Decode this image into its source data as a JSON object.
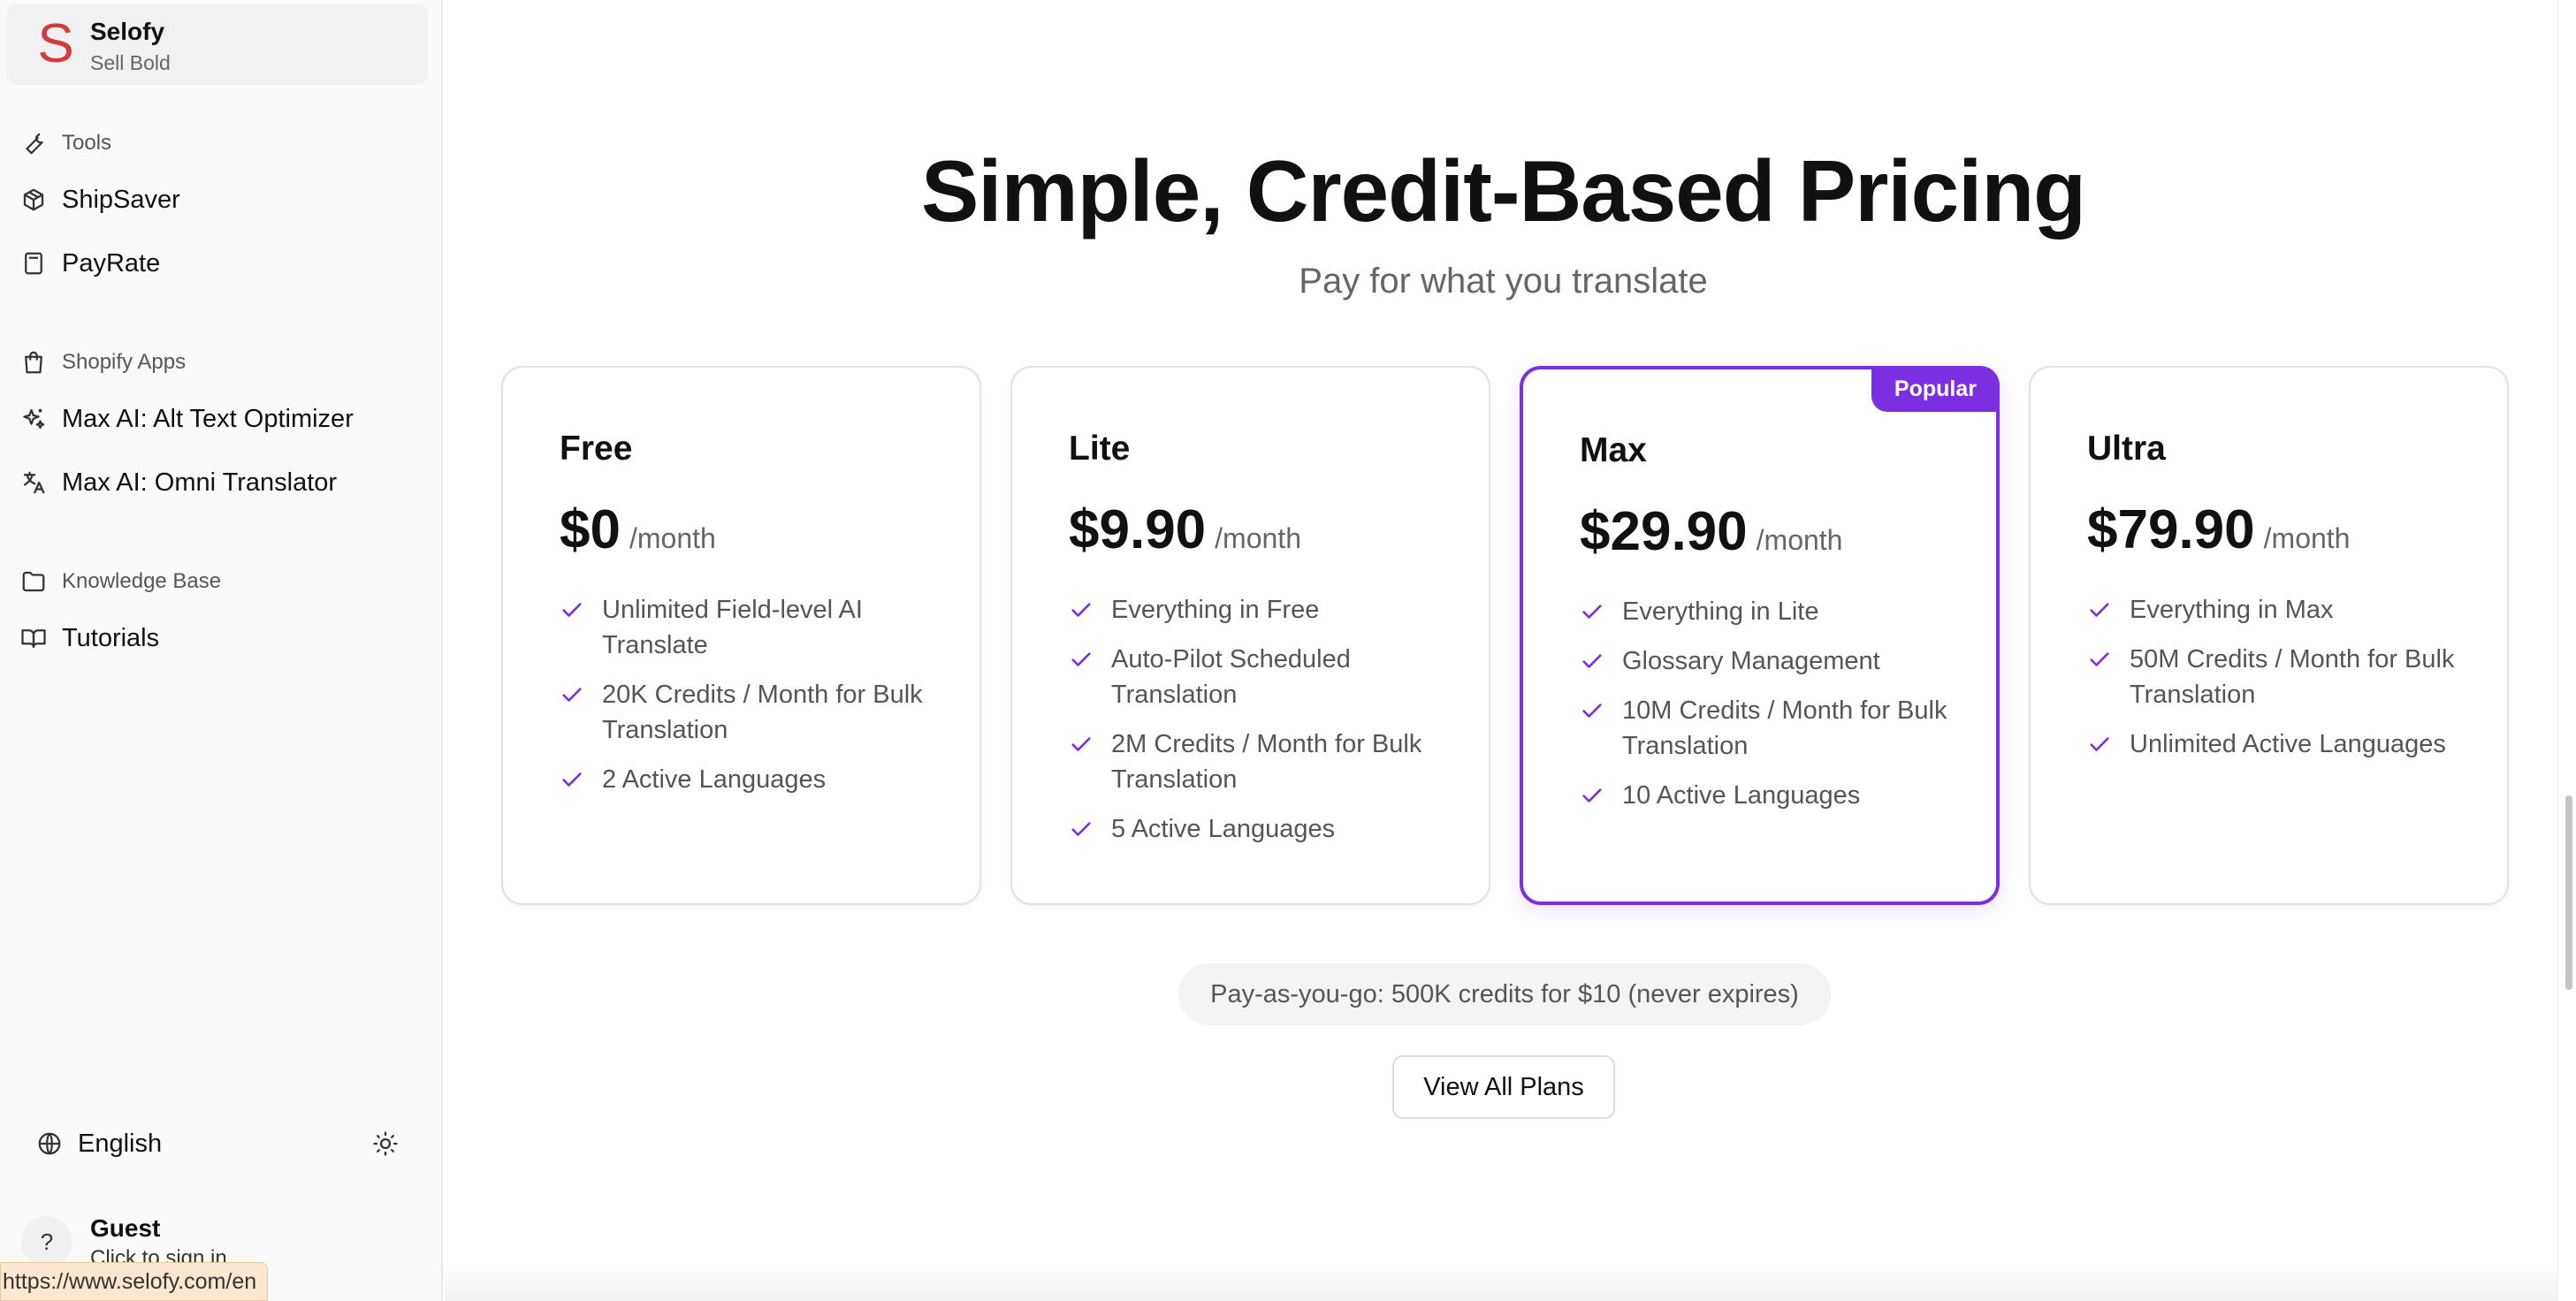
{
  "brand": {
    "logo_letter": "S",
    "name": "Selofy",
    "tagline": "Sell Bold"
  },
  "sidebar": {
    "sections": [
      {
        "label": "Tools",
        "icon": "wrench-icon"
      },
      {
        "label": "Shopify Apps",
        "icon": "shopping-bag-icon"
      },
      {
        "label": "Knowledge Base",
        "icon": "folder-icon"
      }
    ],
    "items": [
      {
        "label": "ShipSaver",
        "icon": "package-icon"
      },
      {
        "label": "PayRate",
        "icon": "calculator-icon"
      },
      {
        "label": "Max AI: Alt Text Optimizer",
        "icon": "sparkles-icon"
      },
      {
        "label": "Max AI: Omni Translator",
        "icon": "translate-icon"
      },
      {
        "label": "Tutorials",
        "icon": "book-icon"
      }
    ],
    "language": "English",
    "theme_icon": "sun-icon",
    "user": {
      "avatar": "?",
      "name": "Guest",
      "subtitle": "Click to sign in"
    }
  },
  "status_url": "https://www.selofy.com/en",
  "main": {
    "title": "Simple, Credit-Based Pricing",
    "subtitle": "Pay for what you translate",
    "plans": [
      {
        "name": "Free",
        "price": "$0",
        "period": "/month",
        "popular": false,
        "features": [
          "Unlimited Field-level AI Translate",
          "20K Credits / Month for Bulk Translation",
          "2 Active Languages"
        ]
      },
      {
        "name": "Lite",
        "price": "$9.90",
        "period": "/month",
        "popular": false,
        "features": [
          "Everything in Free",
          "Auto-Pilot Scheduled Translation",
          "2M Credits / Month for Bulk Translation",
          "5 Active Languages"
        ]
      },
      {
        "name": "Max",
        "price": "$29.90",
        "period": "/month",
        "popular": true,
        "badge": "Popular",
        "features": [
          "Everything in Lite",
          "Glossary Management",
          "10M Credits / Month for Bulk Translation",
          "10 Active Languages"
        ]
      },
      {
        "name": "Ultra",
        "price": "$79.90",
        "period": "/month",
        "popular": false,
        "features": [
          "Everything in Max",
          "50M Credits / Month for Bulk Translation",
          "Unlimited Active Languages"
        ]
      }
    ],
    "payg_note": "Pay-as-you-go: 500K credits for $10 (never expires)",
    "view_all_label": "View All Plans"
  },
  "colors": {
    "accent": "#7b2fe0",
    "brand_logo": "#d63b3b",
    "sidebar_bg": "#fafafa"
  }
}
